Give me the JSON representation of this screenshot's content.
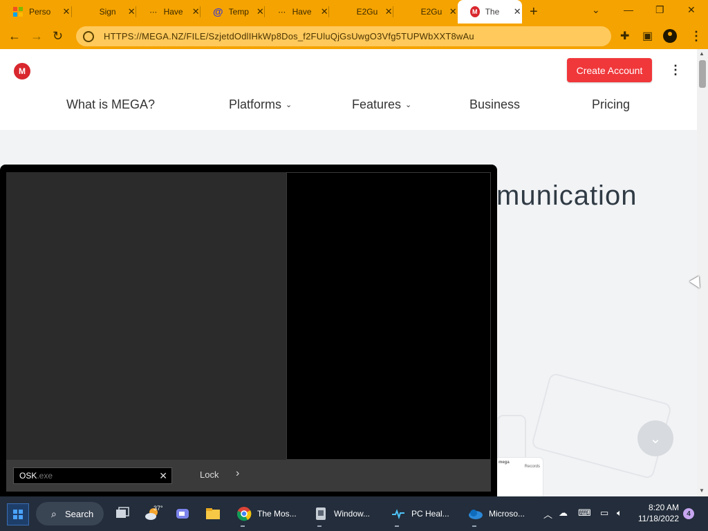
{
  "browser": {
    "tabs": [
      {
        "title": "Perso",
        "active": false
      },
      {
        "title": "Sign",
        "active": false
      },
      {
        "title": "Have",
        "active": false
      },
      {
        "title": "Temp",
        "active": false
      },
      {
        "title": "Have",
        "active": false
      },
      {
        "title": "E2Gu",
        "active": false
      },
      {
        "title": "E2Gu",
        "active": false
      },
      {
        "title": "The",
        "active": true
      }
    ],
    "url": "HTTPS://MEGA.NZ/FILE/SzjetdOdlIHkWp8Dos_f2FUluQjGsUwgO3Vfg5TUPWbXXT8wAu",
    "accent_color": "#f5a300"
  },
  "page": {
    "logo_text": "M",
    "create_account_label": "Create Account",
    "nav": [
      {
        "label": "What is MEGA?"
      },
      {
        "label": "Platforms"
      },
      {
        "label": "Features"
      },
      {
        "label": "Business"
      },
      {
        "label": "Pricing"
      }
    ],
    "hero_fragment": "munication",
    "card_title": "mega",
    "card_subtitle": "Records",
    "brand_color": "#d9272e",
    "button_color": "#f0373a"
  },
  "overlay": {
    "search_typed": "OSK",
    "search_ghost": ".exe",
    "lock_label": "Lock"
  },
  "taskbar": {
    "search_label": "Search",
    "weather_temp": "37°",
    "apps": [
      {
        "label": "The Mos..."
      },
      {
        "label": "Window..."
      },
      {
        "label": "PC Heal..."
      },
      {
        "label": "Microso..."
      }
    ],
    "time": "8:20 AM",
    "date": "11/18/2022",
    "notification_count": "4"
  }
}
